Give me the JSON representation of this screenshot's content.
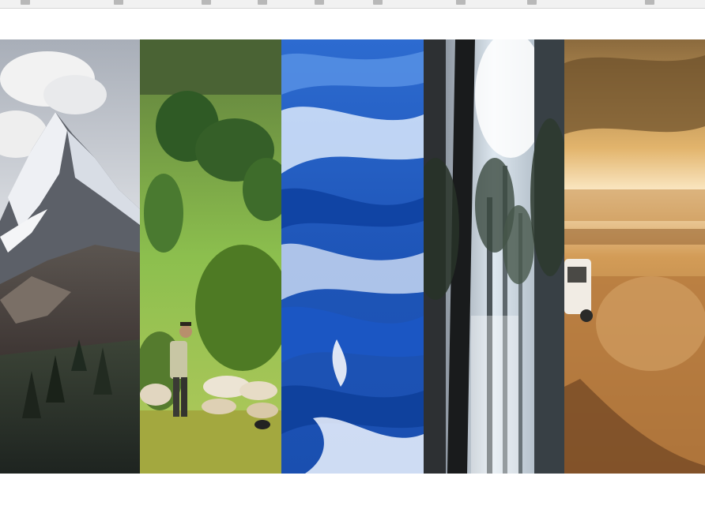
{
  "bookmarks_bar": {
    "items": [
      {
        "icon": "folder-icon",
        "label": ""
      },
      {
        "icon": "folder-icon",
        "label": ""
      },
      {
        "icon": "folder-icon",
        "label": ""
      },
      {
        "icon": "folder-icon",
        "label": ""
      },
      {
        "icon": "folder-icon",
        "label": ""
      },
      {
        "icon": "folder-icon",
        "label": ""
      },
      {
        "icon": "folder-icon",
        "label": ""
      },
      {
        "icon": "folder-icon",
        "label": ""
      },
      {
        "icon": "folder-icon",
        "label": ""
      }
    ]
  },
  "gallery": {
    "panels": [
      {
        "subject": "mountain-peak",
        "accent": "#8d8f95"
      },
      {
        "subject": "shepherd-with-sheep",
        "accent": "#6fa83a"
      },
      {
        "subject": "ocean-wave",
        "accent": "#1f5fc4"
      },
      {
        "subject": "forest-trees",
        "accent": "#c8d6e2"
      },
      {
        "subject": "dusty-road-vehicle",
        "accent": "#c98a3e"
      }
    ]
  }
}
